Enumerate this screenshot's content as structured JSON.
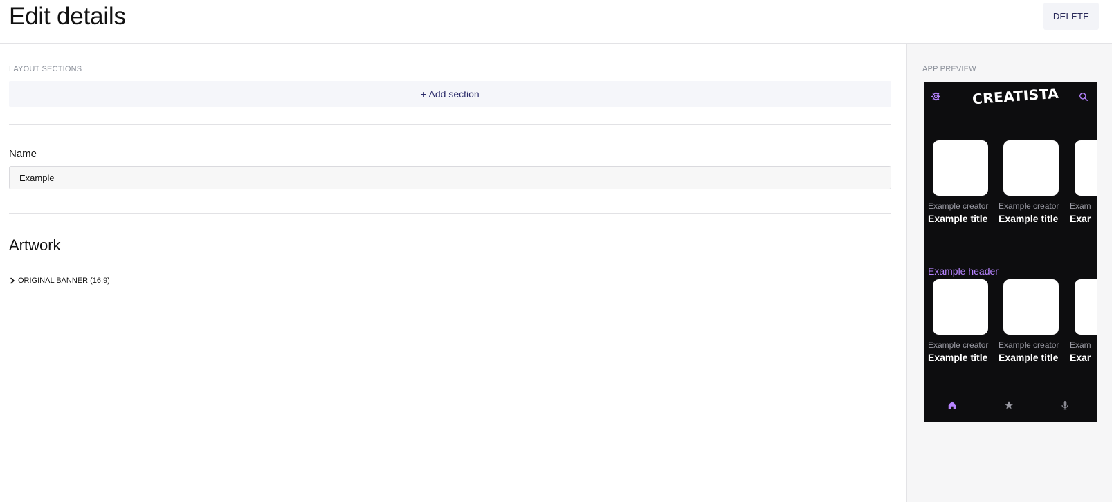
{
  "header": {
    "title": "Edit details",
    "delete_label": "DELETE"
  },
  "main": {
    "layout_sections_label": "LAYOUT SECTIONS",
    "add_section_label": "+ Add section",
    "name_label": "Name",
    "name_value": "Example",
    "artwork_title": "Artwork",
    "artwork_items": [
      {
        "label": "ORIGINAL BANNER (16:9)",
        "icon": "chevron-right-icon"
      }
    ]
  },
  "preview": {
    "label": "APP PREVIEW",
    "app_logo": "CREATISTA",
    "accent_color": "#b784ff",
    "background_color": "#0d0d0f",
    "header_icons": [
      "gear-icon",
      "search-icon"
    ],
    "rows": [
      {
        "header": "",
        "cards": [
          {
            "creator": "Example creator",
            "title": "Example title"
          },
          {
            "creator": "Example creator",
            "title": "Example title"
          },
          {
            "creator": "Exam",
            "title": "Exar"
          }
        ]
      },
      {
        "header": "Example header",
        "cards": [
          {
            "creator": "Example creator",
            "title": "Example title"
          },
          {
            "creator": "Example creator",
            "title": "Example title"
          },
          {
            "creator": "Exam",
            "title": "Exar"
          }
        ]
      }
    ],
    "nav_icons": [
      "home-icon",
      "star-icon",
      "microphone-icon"
    ]
  }
}
